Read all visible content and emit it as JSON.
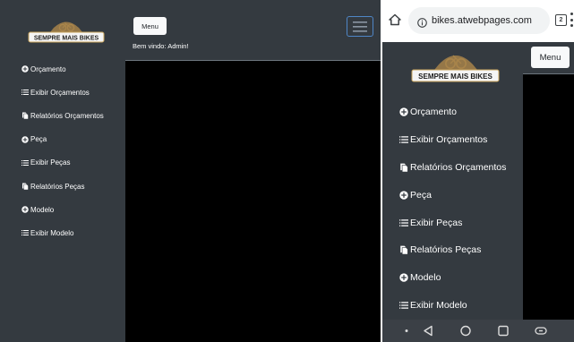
{
  "desktop": {
    "logo_text": "SEMPRE MAIS BIKES",
    "menu_button": "Menu",
    "welcome": "Bem vindo: Admin!",
    "nav": [
      {
        "label": "Orçamento",
        "icon": "plus-circle-icon"
      },
      {
        "label": "Exibir Orçamentos",
        "icon": "list-icon"
      },
      {
        "label": "Relatórios Orçamentos",
        "icon": "copy-icon"
      },
      {
        "label": "Peça",
        "icon": "plus-circle-icon"
      },
      {
        "label": "Exibir Peças",
        "icon": "list-icon"
      },
      {
        "label": "Relatórios Peças",
        "icon": "copy-icon"
      },
      {
        "label": "Modelo",
        "icon": "plus-circle-icon"
      },
      {
        "label": "Exibir Modelo",
        "icon": "list-icon"
      }
    ]
  },
  "mobile": {
    "url": "bikes.atwebpages.com",
    "tab_count": "2",
    "logo_text": "SEMPRE MAIS BIKES",
    "menu_button": "Menu",
    "nav": [
      {
        "label": "Orçamento",
        "icon": "plus-circle-icon"
      },
      {
        "label": "Exibir Orçamentos",
        "icon": "list-icon"
      },
      {
        "label": "Relatórios Orçamentos",
        "icon": "copy-icon"
      },
      {
        "label": "Peça",
        "icon": "plus-circle-icon"
      },
      {
        "label": "Exibir Peças",
        "icon": "list-icon"
      },
      {
        "label": "Relatórios Peças",
        "icon": "copy-icon"
      },
      {
        "label": "Modelo",
        "icon": "plus-circle-icon"
      },
      {
        "label": "Exibir Modelo",
        "icon": "list-icon"
      }
    ],
    "system_nav_icons": [
      "dot-icon",
      "back-icon",
      "home-icon",
      "recents-icon",
      "link-icon"
    ]
  },
  "colors": {
    "sidebar": "#343a40",
    "content": "#000000",
    "button": "#f8f9fa",
    "toggler_border": "#4f86c6",
    "logo_gold": "#b8944a"
  }
}
